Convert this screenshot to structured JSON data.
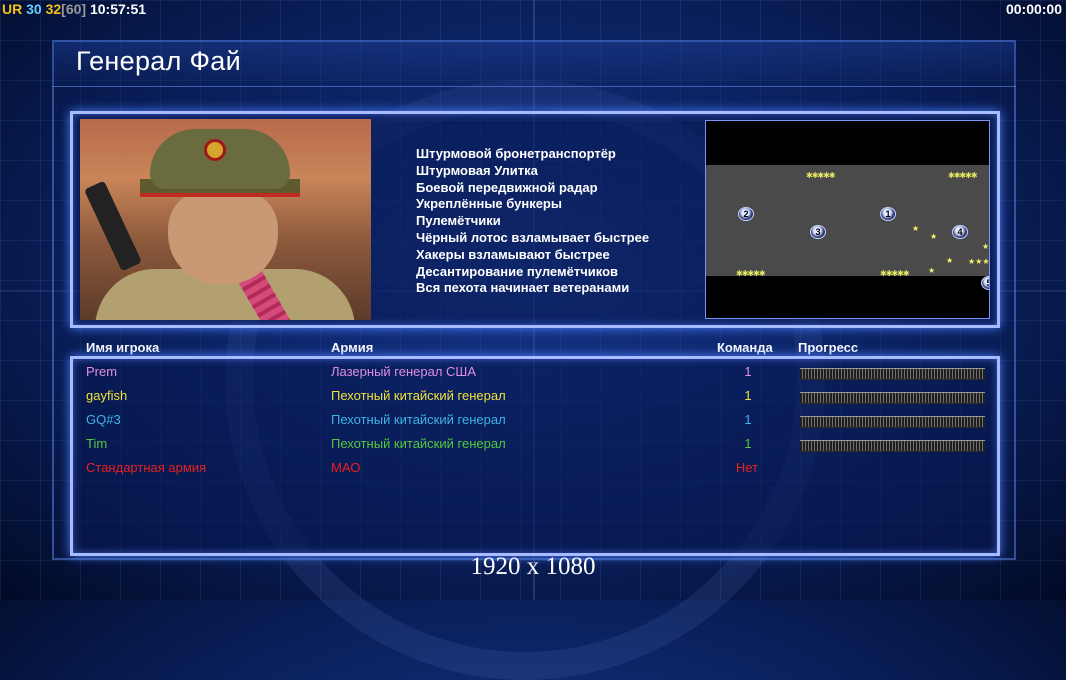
{
  "hud": {
    "ur_label": "UR",
    "val_a": "30",
    "val_b": "32",
    "val_c": "[60]",
    "clock": "10:57:51",
    "timer": "00:00:00"
  },
  "general": {
    "title": "Генерал Фай"
  },
  "upgrades": [
    "Штурмовой бронетранспортёр",
    "Штурмовая Улитка",
    "Боевой передвижной радар",
    "Укреплённые бункеры",
    "Пулемётчики",
    "Чёрный лотос взламывает быстрее",
    "Хакеры взламывают быстрее",
    "Десантирование пулемётчиков",
    "Вся пехота начинает ветеранами"
  ],
  "minimap": {
    "markers": [
      "1",
      "2",
      "3",
      "4",
      "5"
    ]
  },
  "table": {
    "headers": {
      "player": "Имя игрока",
      "army": "Армия",
      "team": "Команда",
      "progress": "Прогресс"
    },
    "rows": [
      {
        "name": "Prem",
        "army": "Лазерный генерал США",
        "team": "1",
        "color": "#e08fe0",
        "progress": 1.0
      },
      {
        "name": "gayfish",
        "army": "Пехотный китайский генерал",
        "team": "1",
        "color": "#f0e23a",
        "progress": 1.0
      },
      {
        "name": "GQ#3",
        "army": "Пехотный китайский генерал",
        "team": "1",
        "color": "#3fb4e8",
        "progress": 1.0
      },
      {
        "name": "Tim",
        "army": "Пехотный китайский генерал",
        "team": "1",
        "color": "#55c83c",
        "progress": 1.0
      },
      {
        "name": "Стандартная армия",
        "army": "МАО",
        "team": "Нет",
        "color": "#e82020"
      }
    ]
  },
  "resolution": "1920 x 1080"
}
